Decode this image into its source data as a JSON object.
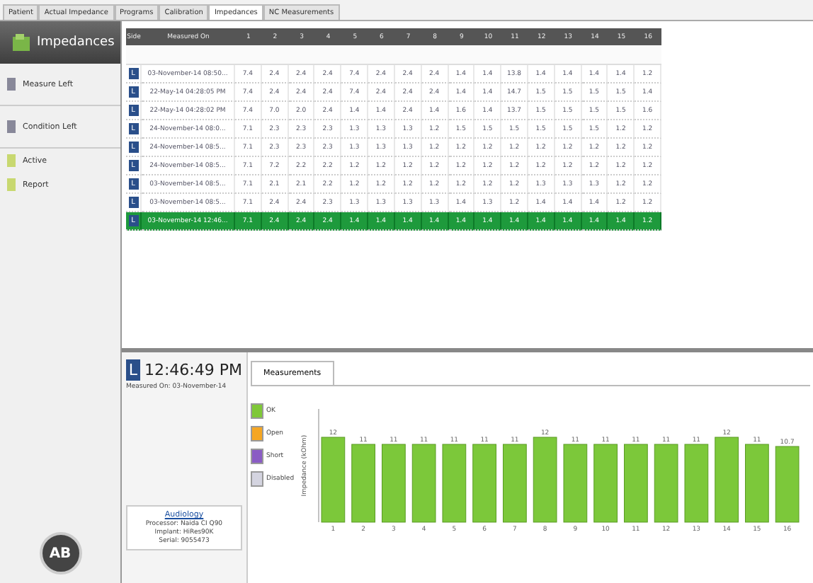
{
  "tabs": [
    {
      "label": "Patient",
      "selected": false
    },
    {
      "label": "Actual Impedance",
      "selected": false
    },
    {
      "label": "Programs",
      "selected": false
    },
    {
      "label": "Calibration",
      "selected": false
    },
    {
      "label": "Impedances",
      "selected": true
    },
    {
      "label": "NC Measurements",
      "selected": false
    }
  ],
  "sidebar": {
    "title": "Impedances",
    "items": [
      {
        "label": "Measure Left",
        "kind": "big"
      },
      {
        "label": "Condition Left",
        "kind": "big"
      },
      {
        "label": "Active",
        "kind": "small"
      },
      {
        "label": "Report",
        "kind": "small"
      }
    ],
    "logo": "AB"
  },
  "table": {
    "columns": [
      "Side",
      "Measured On",
      "1",
      "2",
      "3",
      "4",
      "5",
      "6",
      "7",
      "8",
      "9",
      "10",
      "11",
      "12",
      "13",
      "14",
      "15",
      "16"
    ],
    "rows": [
      {
        "side": "L",
        "date": "03-November-14 08:50...",
        "values": [
          "7.4",
          "2.4",
          "2.4",
          "2.4",
          "7.4",
          "2.4",
          "2.4",
          "2.4",
          "1.4",
          "1.4",
          "13.8",
          "1.4",
          "1.4",
          "1.4",
          "1.4",
          "1.2"
        ],
        "selected": false
      },
      {
        "side": "L",
        "date": "22-May-14 04:28:05 PM",
        "values": [
          "7.4",
          "2.4",
          "2.4",
          "2.4",
          "7.4",
          "2.4",
          "2.4",
          "2.4",
          "1.4",
          "1.4",
          "14.7",
          "1.5",
          "1.5",
          "1.5",
          "1.5",
          "1.4"
        ],
        "selected": false
      },
      {
        "side": "L",
        "date": "22-May-14 04:28:02 PM",
        "values": [
          "7.4",
          "7.0",
          "2.0",
          "2.4",
          "1.4",
          "1.4",
          "2.4",
          "1.4",
          "1.6",
          "1.4",
          "13.7",
          "1.5",
          "1.5",
          "1.5",
          "1.5",
          "1.6"
        ],
        "selected": false
      },
      {
        "side": "L",
        "date": "24-November-14 08:0...",
        "values": [
          "7.1",
          "2.3",
          "2.3",
          "2.3",
          "1.3",
          "1.3",
          "1.3",
          "1.2",
          "1.5",
          "1.5",
          "1.5",
          "1.5",
          "1.5",
          "1.5",
          "1.2",
          "1.2"
        ],
        "selected": false
      },
      {
        "side": "L",
        "date": "24-November-14 08:5...",
        "values": [
          "7.1",
          "2.3",
          "2.3",
          "2.3",
          "1.3",
          "1.3",
          "1.3",
          "1.2",
          "1.2",
          "1.2",
          "1.2",
          "1.2",
          "1.2",
          "1.2",
          "1.2",
          "1.2"
        ],
        "selected": false
      },
      {
        "side": "L",
        "date": "24-November-14 08:5...",
        "values": [
          "7.1",
          "7.2",
          "2.2",
          "2.2",
          "1.2",
          "1.2",
          "1.2",
          "1.2",
          "1.2",
          "1.2",
          "1.2",
          "1.2",
          "1.2",
          "1.2",
          "1.2",
          "1.2"
        ],
        "selected": false
      },
      {
        "side": "L",
        "date": "03-November-14 08:5...",
        "values": [
          "7.1",
          "2.1",
          "2.1",
          "2.2",
          "1.2",
          "1.2",
          "1.2",
          "1.2",
          "1.2",
          "1.2",
          "1.2",
          "1.3",
          "1.3",
          "1.3",
          "1.2",
          "1.2"
        ],
        "selected": false
      },
      {
        "side": "L",
        "date": "03-November-14 08:5...",
        "values": [
          "7.1",
          "2.4",
          "2.4",
          "2.3",
          "1.3",
          "1.3",
          "1.3",
          "1.3",
          "1.4",
          "1.3",
          "1.2",
          "1.4",
          "1.4",
          "1.4",
          "1.2",
          "1.2"
        ],
        "selected": false
      },
      {
        "side": "L",
        "date": "03-November-14 12:46...",
        "values": [
          "7.1",
          "2.4",
          "2.4",
          "2.4",
          "1.4",
          "1.4",
          "1.4",
          "1.4",
          "1.4",
          "1.4",
          "1.4",
          "1.4",
          "1.4",
          "1.4",
          "1.4",
          "1.2"
        ],
        "selected": true
      }
    ]
  },
  "detail": {
    "side": "L",
    "time": "12:46:49 PM",
    "measured_on": "Measured On: 03-November-14",
    "tabs": [
      {
        "label": "Measurements",
        "selected": true
      }
    ],
    "card": {
      "link": "Audiology",
      "lines": [
        "Processor: Naida CI Q90",
        "Implant: HiRes90K",
        "Serial: 9055473"
      ]
    },
    "legend": [
      {
        "label": "OK",
        "color": "#7fc838"
      },
      {
        "label": "Open",
        "color": "#f5a623"
      },
      {
        "label": "Short",
        "color": "#8a5cc4"
      },
      {
        "label": "Disabled",
        "color": "#d4d4e0"
      }
    ],
    "chart_data": {
      "type": "bar",
      "ylabel": "Impedance (kOhm)",
      "categories": [
        "1",
        "2",
        "3",
        "4",
        "5",
        "6",
        "7",
        "8",
        "9",
        "10",
        "11",
        "12",
        "13",
        "14",
        "15",
        "16"
      ],
      "values": [
        12,
        11,
        11,
        11,
        11,
        11,
        11,
        12,
        11,
        11,
        11,
        11,
        11,
        12,
        11,
        10.7
      ],
      "data_labels": true
    }
  }
}
